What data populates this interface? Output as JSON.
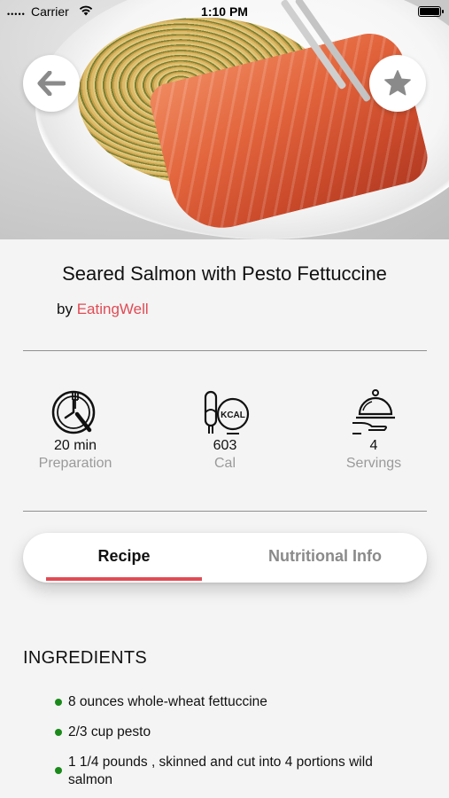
{
  "status_bar": {
    "signal": "•••••",
    "carrier": "Carrier",
    "time": "1:10 PM"
  },
  "hero": {
    "image_alt": "Seared salmon fillet with pesto fettuccine on a white plate"
  },
  "recipe": {
    "title": "Seared Salmon with Pesto Fettuccine",
    "by_prefix": "by",
    "author": "EatingWell"
  },
  "stats": [
    {
      "icon": "clock-icon",
      "value": "20 min",
      "label": "Preparation"
    },
    {
      "icon": "kcal-icon",
      "value": "603",
      "label": "Cal"
    },
    {
      "icon": "serving-cloche-icon",
      "value": "4",
      "label": "Servings"
    }
  ],
  "tabs": [
    {
      "label": "Recipe",
      "active": true
    },
    {
      "label": "Nutritional Info",
      "active": false
    }
  ],
  "ingredients": {
    "heading": "INGREDIENTS",
    "items": [
      "8 ounces whole-wheat fettuccine",
      "2/3 cup pesto",
      "1 1/4 pounds , skinned and cut into 4 portions wild salmon"
    ]
  },
  "colors": {
    "accent": "#e14b55",
    "bullet": "#1a8a1a",
    "background": "#f4f4f4"
  }
}
